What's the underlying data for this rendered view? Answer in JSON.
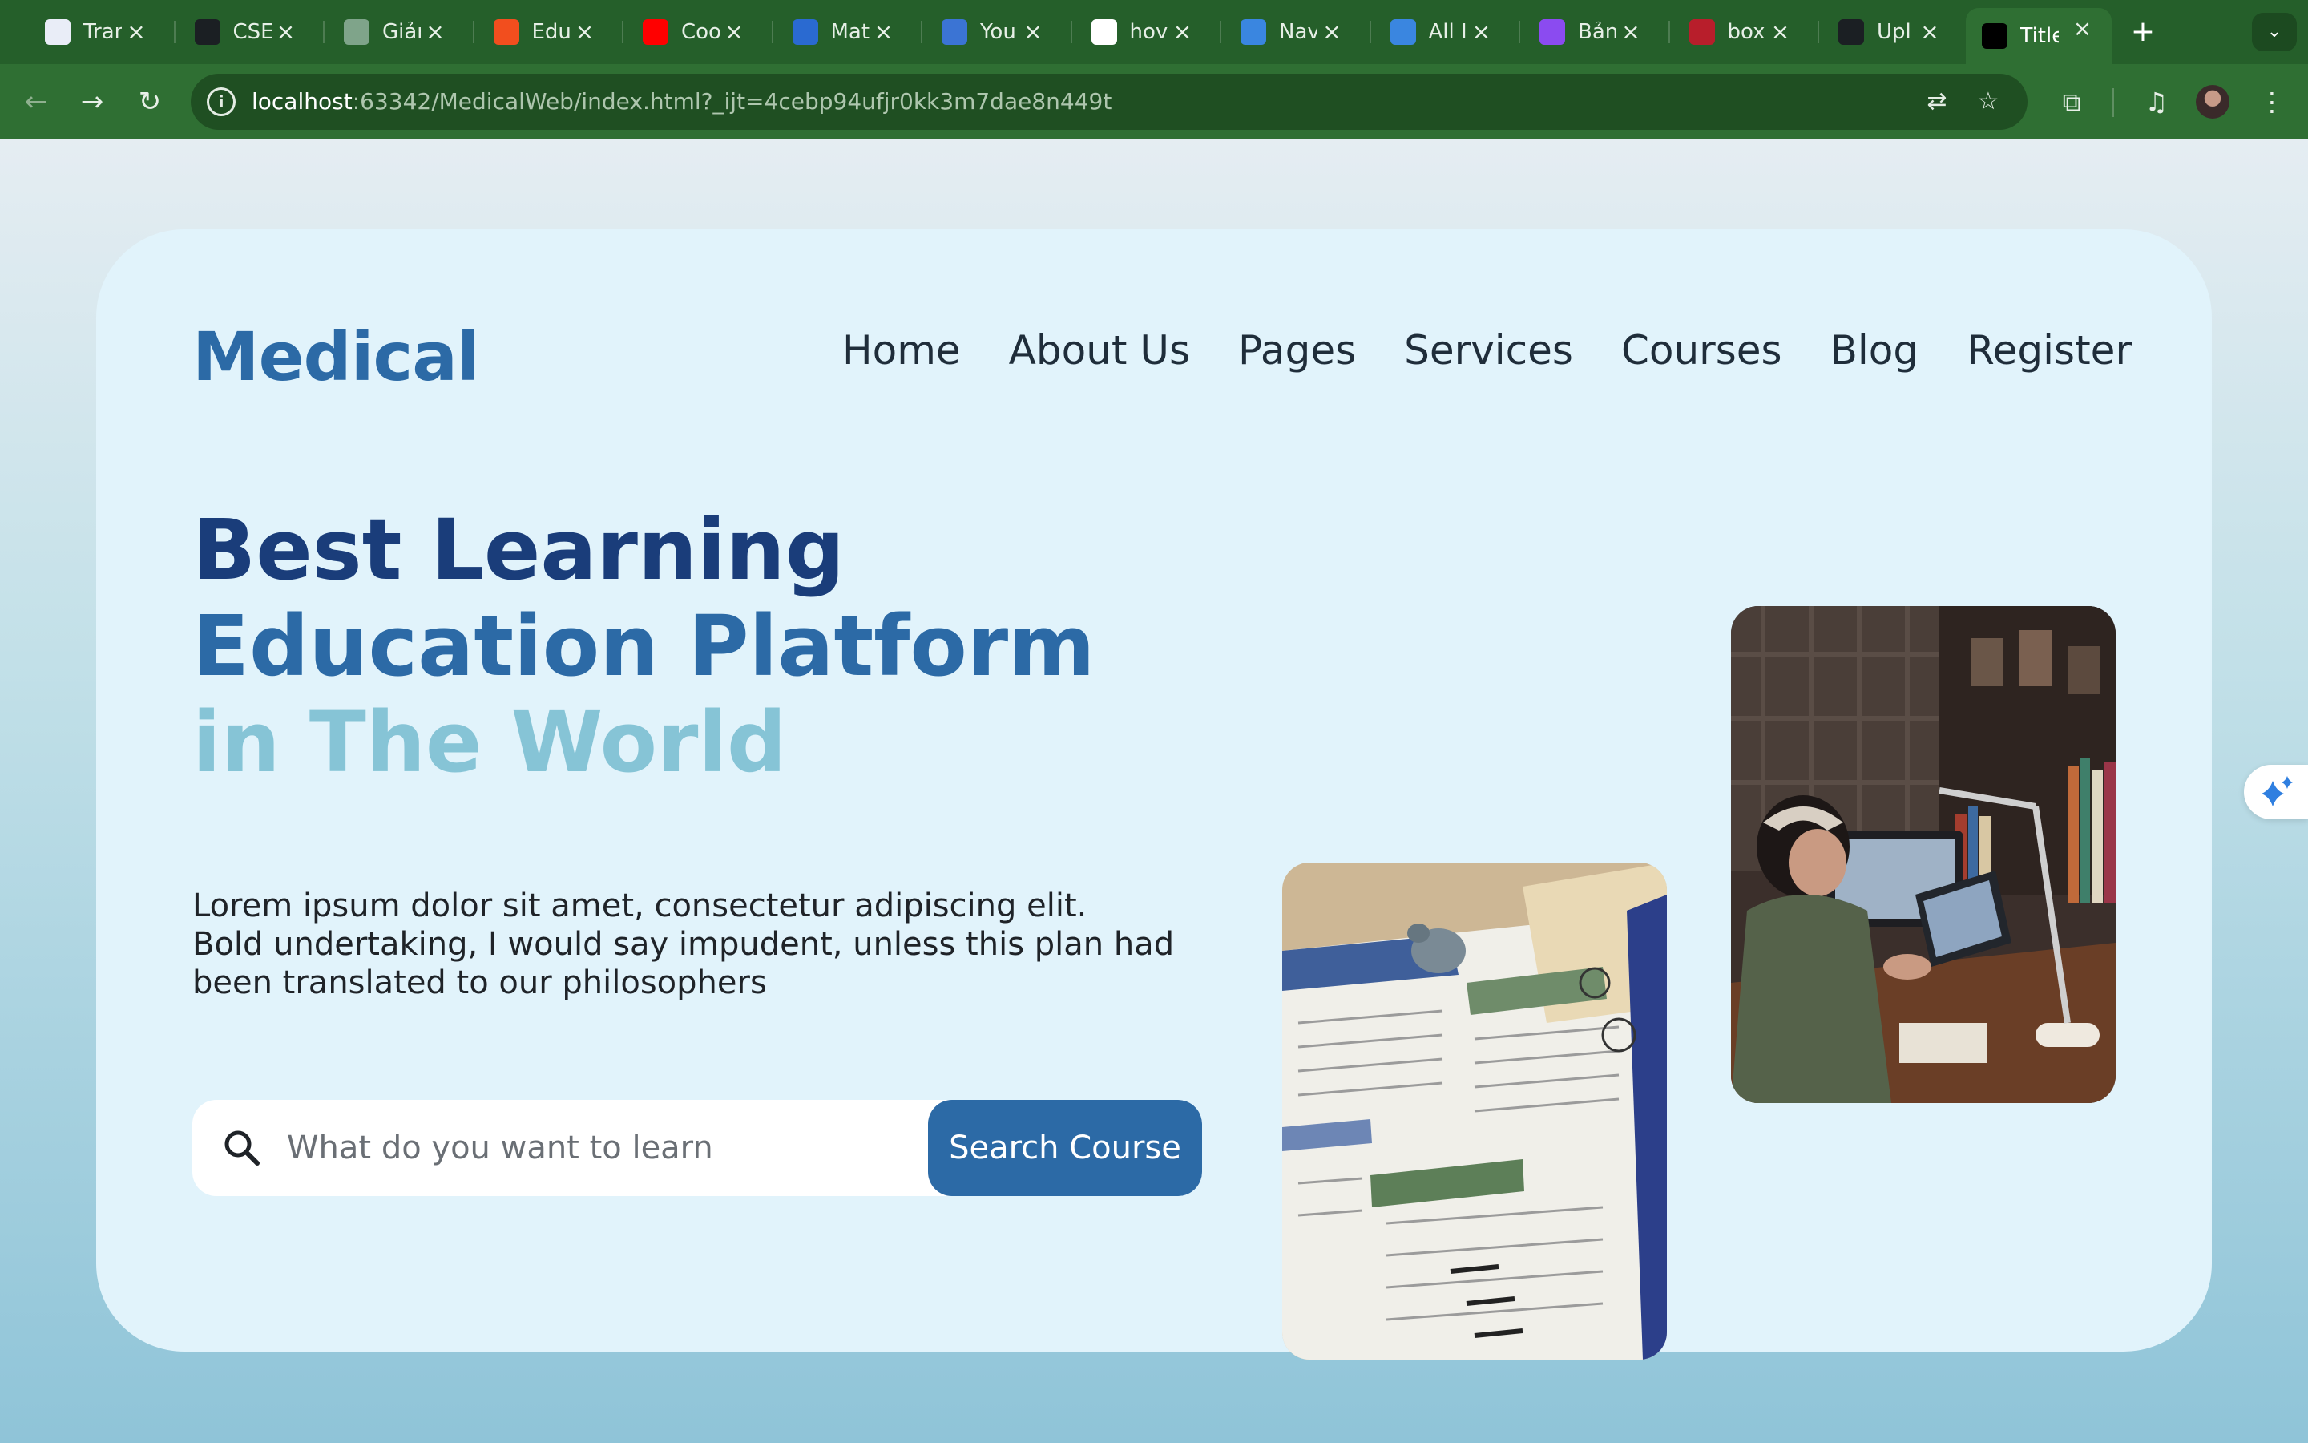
{
  "browser": {
    "tabs": [
      {
        "title": "Tran",
        "icon": "translate-app-icon",
        "color": "#e9edf7"
      },
      {
        "title": "CSE",
        "icon": "github-icon",
        "color": "#1b1f23"
      },
      {
        "title": "Giản",
        "icon": "chatgpt-icon",
        "color": "#7fa48a"
      },
      {
        "title": "Edu",
        "icon": "figma-icon",
        "color": "#f24e1e"
      },
      {
        "title": "Coo",
        "icon": "youtube-icon",
        "color": "#ff0000"
      },
      {
        "title": "Mat",
        "icon": "material-icon",
        "color": "#2a6ad1"
      },
      {
        "title": "You",
        "icon": "flag-icon",
        "color": "#3b74d4"
      },
      {
        "title": "hov",
        "icon": "google-icon",
        "color": "#ffffff"
      },
      {
        "title": "Nav",
        "icon": "codelearn-icon",
        "color": "#3a86e0"
      },
      {
        "title": "All I",
        "icon": "codelearn-icon",
        "color": "#3a86e0"
      },
      {
        "title": "Bản",
        "icon": "canva-icon",
        "color": "#8b4bf0"
      },
      {
        "title": "box",
        "icon": "wattpad-icon",
        "color": "#b81e2b"
      },
      {
        "title": "Upl",
        "icon": "github-icon",
        "color": "#1b1f23"
      },
      {
        "title": "Title",
        "icon": "webstorm-icon",
        "color": "#000000"
      }
    ],
    "url_host": "localhost",
    "url_rest": ":63342/MedicalWeb/index.html?_ijt=4cebp94ufjr0kk3m7dae8n449t"
  },
  "site": {
    "logo": "Medical",
    "nav": [
      "Home",
      "About Us",
      "Pages",
      "Services",
      "Courses",
      "Blog",
      "Register"
    ],
    "headline": {
      "line1": "Best Learning",
      "line2": "Education Platform",
      "line3": "in The World"
    },
    "description": {
      "line1": "Lorem ipsum dolor sit amet, consectetur adipiscing elit.",
      "line2": "Bold undertaking, I would say impudent, unless this plan had been translated to our philosophers"
    },
    "search": {
      "placeholder": "What do you want to learn",
      "button": "Search Course"
    }
  },
  "colors": {
    "logo": "#2c6aa6",
    "headline_dark": "#1a3d7a",
    "headline_mid": "#2c6aa6",
    "headline_light": "#86c4d6",
    "button": "#2c6aa6",
    "card": "#e1f3fb"
  }
}
